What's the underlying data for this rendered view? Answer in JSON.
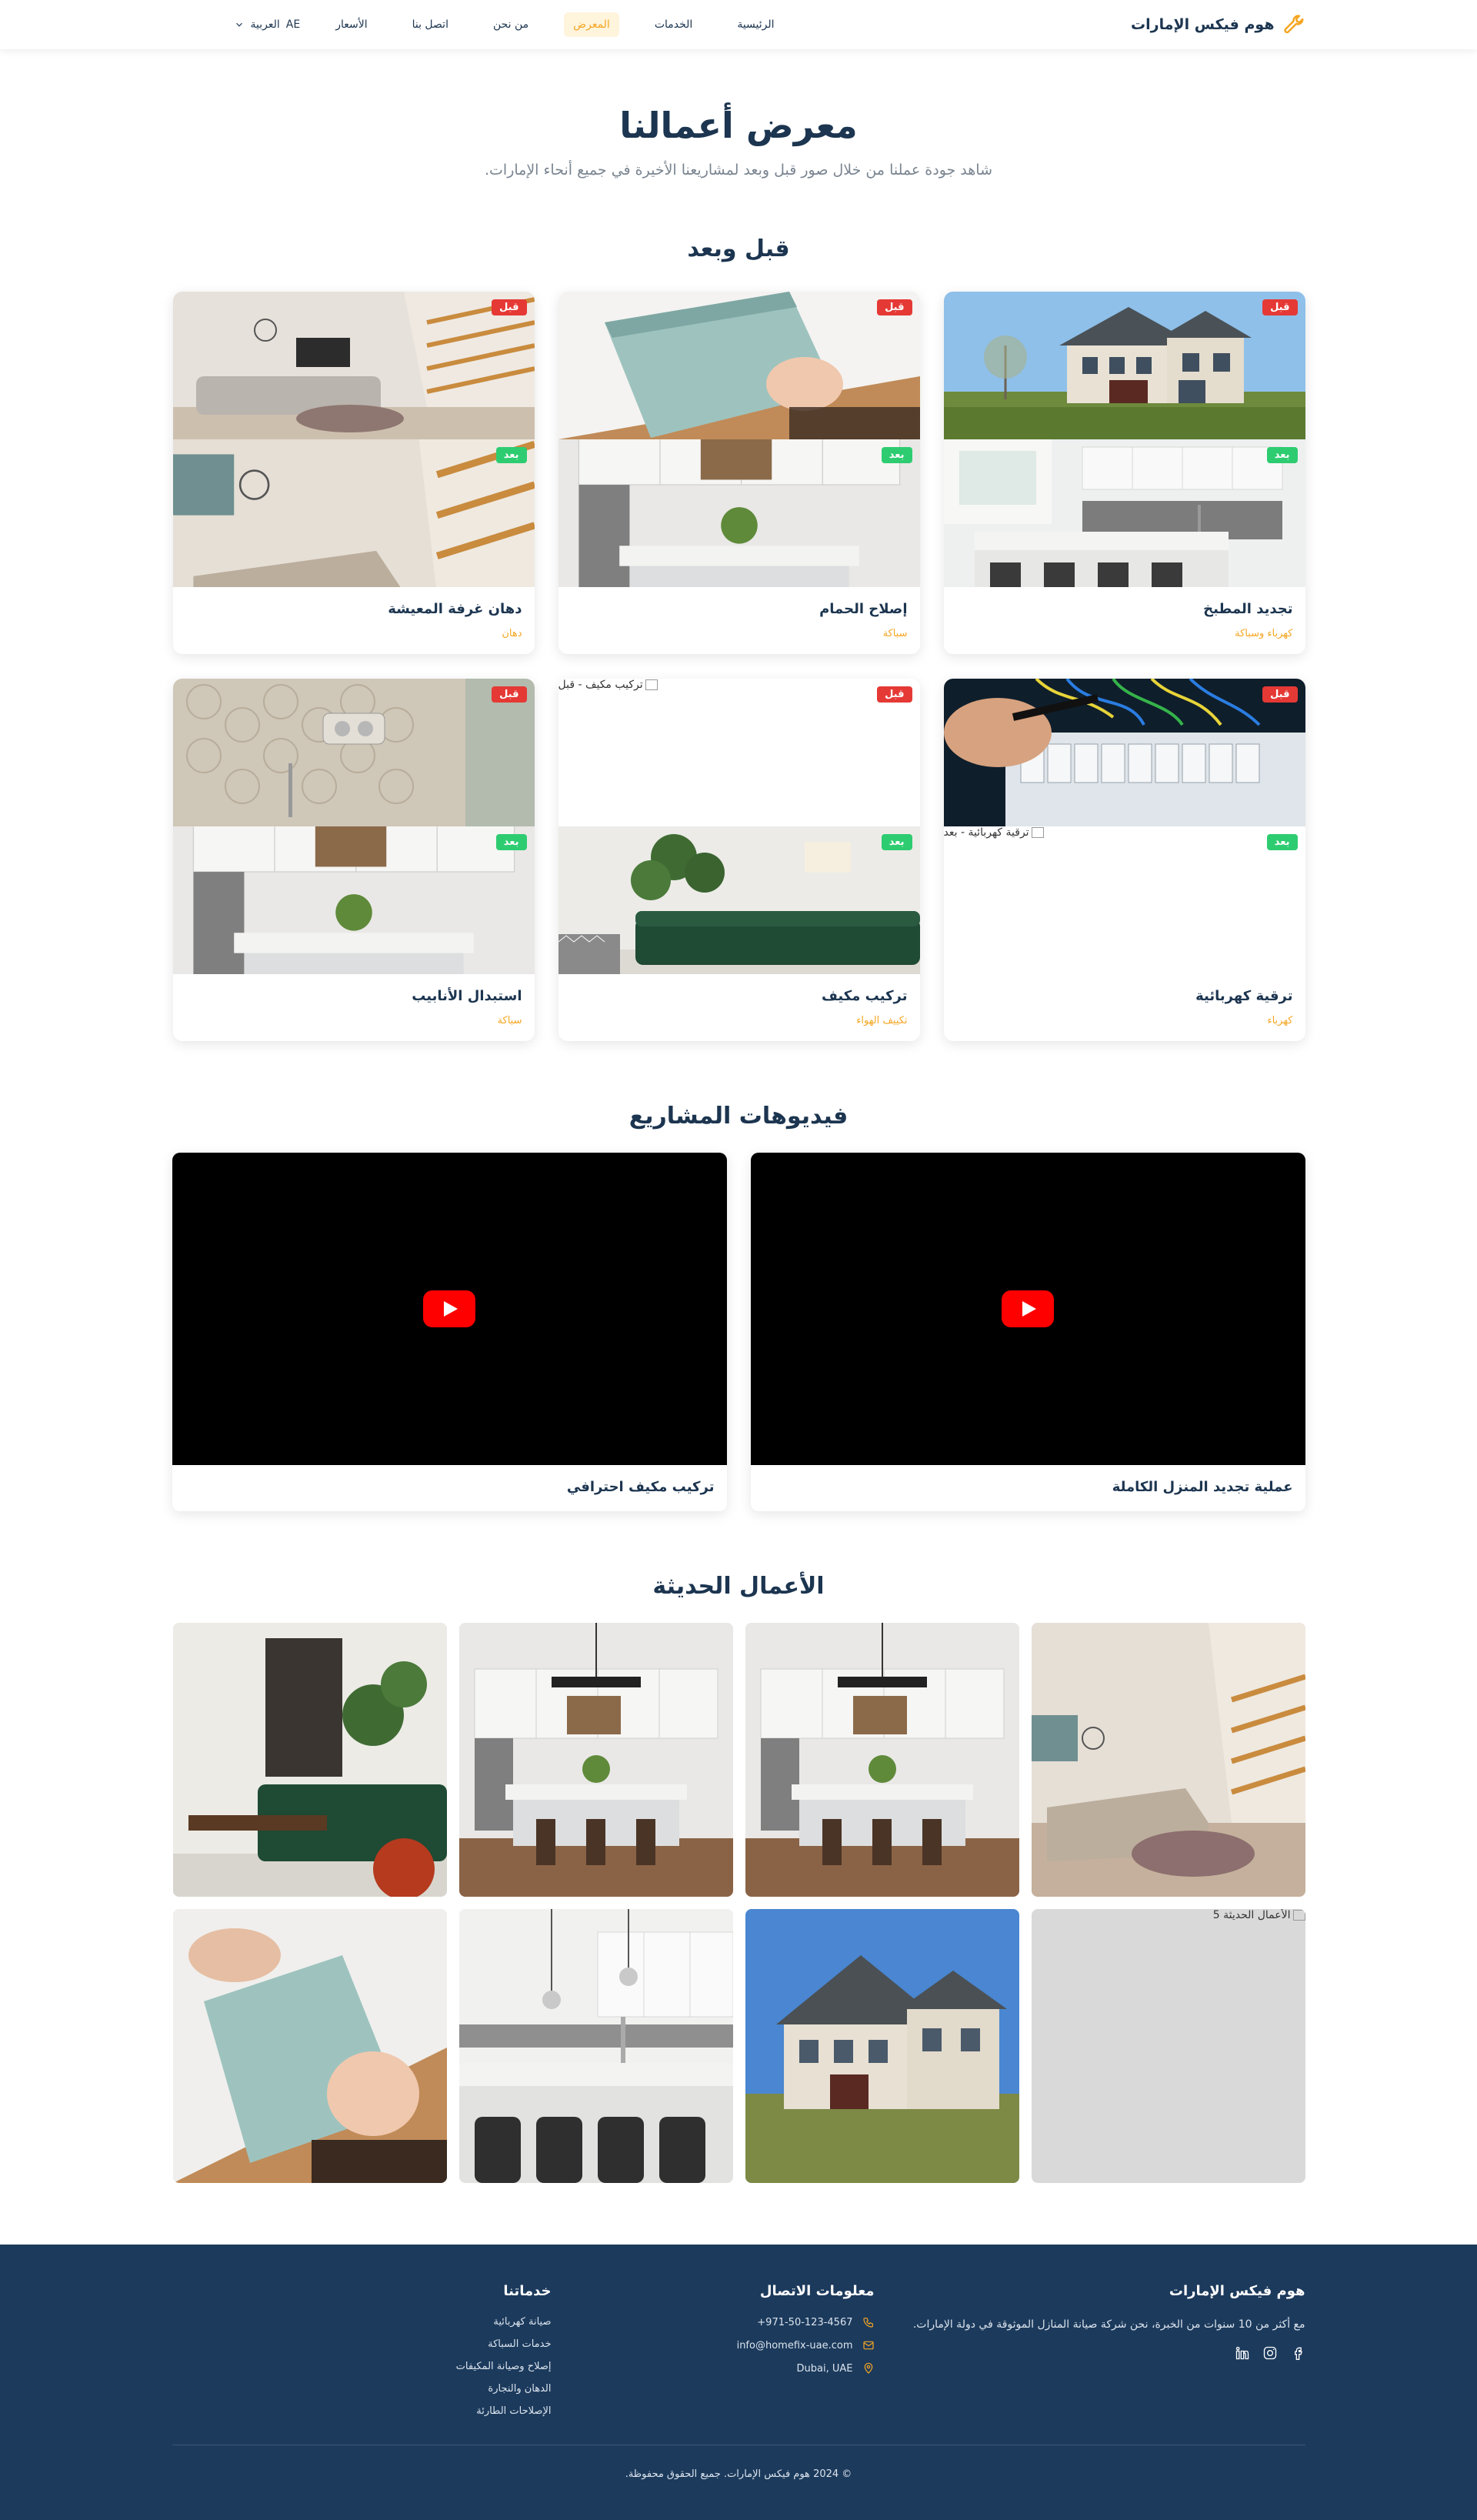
{
  "nav": {
    "brand": "هوم فيكس الإمارات",
    "links": [
      "الرئيسية",
      "الخدمات",
      "المعرض",
      "من نحن",
      "اتصل بنا",
      "الأسعار"
    ],
    "active_index": 2,
    "lang_code": "AE",
    "lang_label": "العربية"
  },
  "hero": {
    "title": "معرض أعمالنا",
    "subtitle": "شاهد جودة عملنا من خلال صور قبل وبعد لمشاريعنا الأخيرة في جميع أنحاء الإمارات."
  },
  "before_after": {
    "title": "قبل وبعد",
    "before_label": "قبل",
    "after_label": "بعد",
    "cards": [
      {
        "title": "تجديد المطبخ",
        "category": "كهرباء وسباكة"
      },
      {
        "title": "إصلاح الحمام",
        "category": "سباكة"
      },
      {
        "title": "دهان غرفة المعيشة",
        "category": "دهان"
      },
      {
        "title": "ترقية كهربائية",
        "category": "كهرباء",
        "broken_after_alt": "ترقية كهربائية - بعد"
      },
      {
        "title": "تركيب مكيف",
        "category": "تكييف الهواء",
        "broken_before_alt": "تركيب مكيف - قبل"
      },
      {
        "title": "استبدال الأنابيب",
        "category": "سباكة"
      }
    ]
  },
  "videos": {
    "title": "فيديوهات المشاريع",
    "items": [
      {
        "title": "عملية تجديد المنزل الكاملة"
      },
      {
        "title": "تركيب مكيف احترافي"
      }
    ]
  },
  "recent": {
    "title": "الأعمال الحديثة",
    "broken_alt": "الأعمال الحديثة 5"
  },
  "footer": {
    "brand_title": "هوم فيكس الإمارات",
    "brand_desc": "مع أكثر من 10 سنوات من الخبرة، نحن شركة صيانة المنازل الموثوقة في دولة الإمارات.",
    "contact_title": "معلومات الاتصال",
    "phone": "+971-50-123-4567",
    "email": "info@homefix-uae.com",
    "location": "Dubai, UAE",
    "services_title": "خدماتنا",
    "services": [
      "صيانة كهربائية",
      "خدمات السباكة",
      "إصلاح وصيانة المكيفات",
      "الدهان والنجارة",
      "الإصلاحات الطارئة"
    ],
    "copyright": "© 2024 هوم فيكس الإمارات. جميع الحقوق محفوظة."
  },
  "colors": {
    "primary": "#1c3550",
    "accent": "#f5a623",
    "before_badge": "#e53935",
    "after_badge": "#2ecc71",
    "footer_bg": "#1c3a5c",
    "play_red": "#ff0000"
  }
}
